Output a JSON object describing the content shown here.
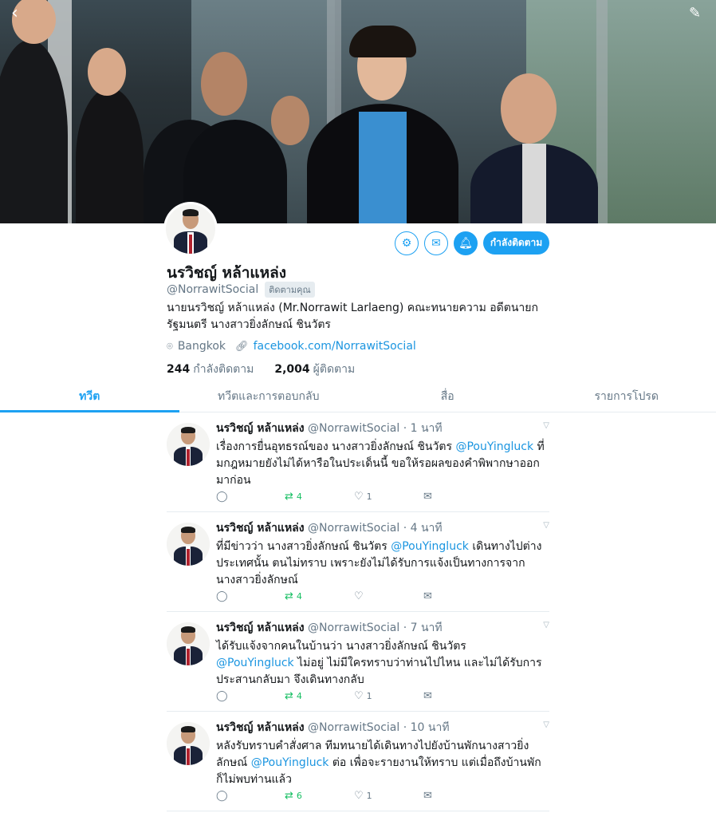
{
  "nav": {
    "back_icon": "chevron-left-icon",
    "compose_icon": "compose-feather-icon"
  },
  "profile": {
    "name": "นรวิชญ์ หล้าแหล่ง",
    "handle": "@NorrawitSocial",
    "follows_you": "ติดตามคุณ",
    "bio": "นายนรวิชญ์ หล้าแหล่ง (Mr.Norrawit Larlaeng) คณะทนายความ อดีตนายก รัฐมนตรี นางสาวยิ่งลักษณ์ ชินวัตร",
    "location": "Bangkok",
    "website": "facebook.com/NorrawitSocial",
    "following_count": "244",
    "following_label": "กำลังติดตาม",
    "followers_count": "2,004",
    "followers_label": "ผู้ติดตาม",
    "follow_button": "กำลังติดตาม"
  },
  "tabs": [
    {
      "label": "ทวีต",
      "active": true
    },
    {
      "label": "ทวีตและการตอบกลับ",
      "active": false
    },
    {
      "label": "สื่อ",
      "active": false
    },
    {
      "label": "รายการโปรด",
      "active": false
    }
  ],
  "tweets": [
    {
      "name": "นรวิชญ์ หล้าแหล่ง",
      "meta": "@NorrawitSocial · 1 นาที",
      "text_before": "เรื่องการยื่นอุทธรณ์ของ นางสาวยิ่งลักษณ์ ชินวัตร ",
      "mention": "@PouYingluck",
      "text_after": " ที่มกฎหมายยังไม่ได้หารือในประเด็นนี้ ขอให้รอผลของคำพิพากษาออกมาก่อน",
      "retweets": "4",
      "likes": "1"
    },
    {
      "name": "นรวิชญ์ หล้าแหล่ง",
      "meta": "@NorrawitSocial · 4 นาที",
      "text_before": "ที่มีข่าวว่า นางสาวยิ่งลักษณ์ ชินวัตร ",
      "mention": "@PouYingluck",
      "text_after": " เดินทางไปต่างประเทศนั้น ตนไม่ทราบ เพราะยังไม่ได้รับการแจ้งเป็นทางการจาก นางสาวยิ่งลักษณ์",
      "retweets": "4",
      "likes": ""
    },
    {
      "name": "นรวิชญ์ หล้าแหล่ง",
      "meta": "@NorrawitSocial · 7 นาที",
      "text_before": "ได้รับแจ้งจากคนในบ้านว่า นางสาวยิ่งลักษณ์ ชินวัตร ",
      "mention": "@PouYingluck",
      "text_after": " ไม่อยู่ ไม่มีใครทราบว่าท่านไปไหน และไม่ได้รับการประสานกลับมา จึงเดินทางกลับ",
      "retweets": "4",
      "likes": "1"
    },
    {
      "name": "นรวิชญ์ หล้าแหล่ง",
      "meta": "@NorrawitSocial · 10 นาที",
      "text_before": "หลังรับทราบคำสั่งศาล ทีมทนายได้เดินทางไปยังบ้านพักนางสาวยิ่งลักษณ์ ",
      "mention": "@PouYingluck",
      "text_after": " ต่อ เพื่อจะรายงานให้ทราบ แต่เมื่อถึงบ้านพักก็ไม่พบท่านแล้ว",
      "retweets": "6",
      "likes": "1"
    }
  ],
  "colors": {
    "accent": "#1da1f2",
    "retweet": "#17bf63",
    "muted": "#657786"
  }
}
